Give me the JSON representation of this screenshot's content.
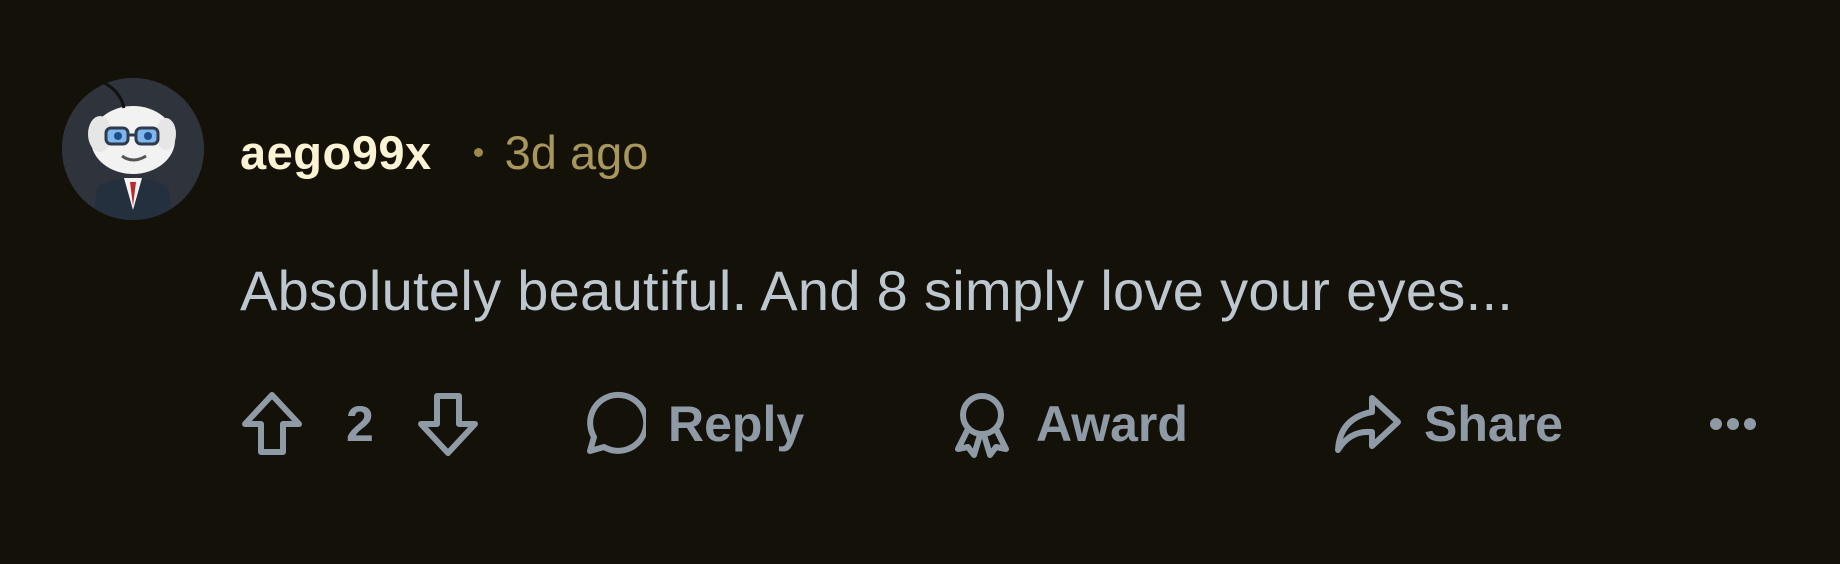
{
  "comment": {
    "username": "aego99x",
    "separator": "•",
    "timestamp": "3d ago",
    "body": "Absolutely beautiful. And 8 simply love your eyes...",
    "avatar_icon": "snoo-avatar-icon"
  },
  "actions": {
    "upvote_icon": "arrow-up-icon",
    "vote_count": "2",
    "downvote_icon": "arrow-down-icon",
    "reply_label": "Reply",
    "reply_icon": "speech-bubble-icon",
    "award_label": "Award",
    "award_icon": "award-ribbon-icon",
    "share_label": "Share",
    "share_icon": "share-arrow-icon",
    "more_icon": "more-dots-icon"
  },
  "colors": {
    "background": "#141108",
    "username": "#fbf3d4",
    "timestamp": "#a8965a",
    "body_text": "#bcc7d0",
    "action_text": "#8e9aa5"
  }
}
